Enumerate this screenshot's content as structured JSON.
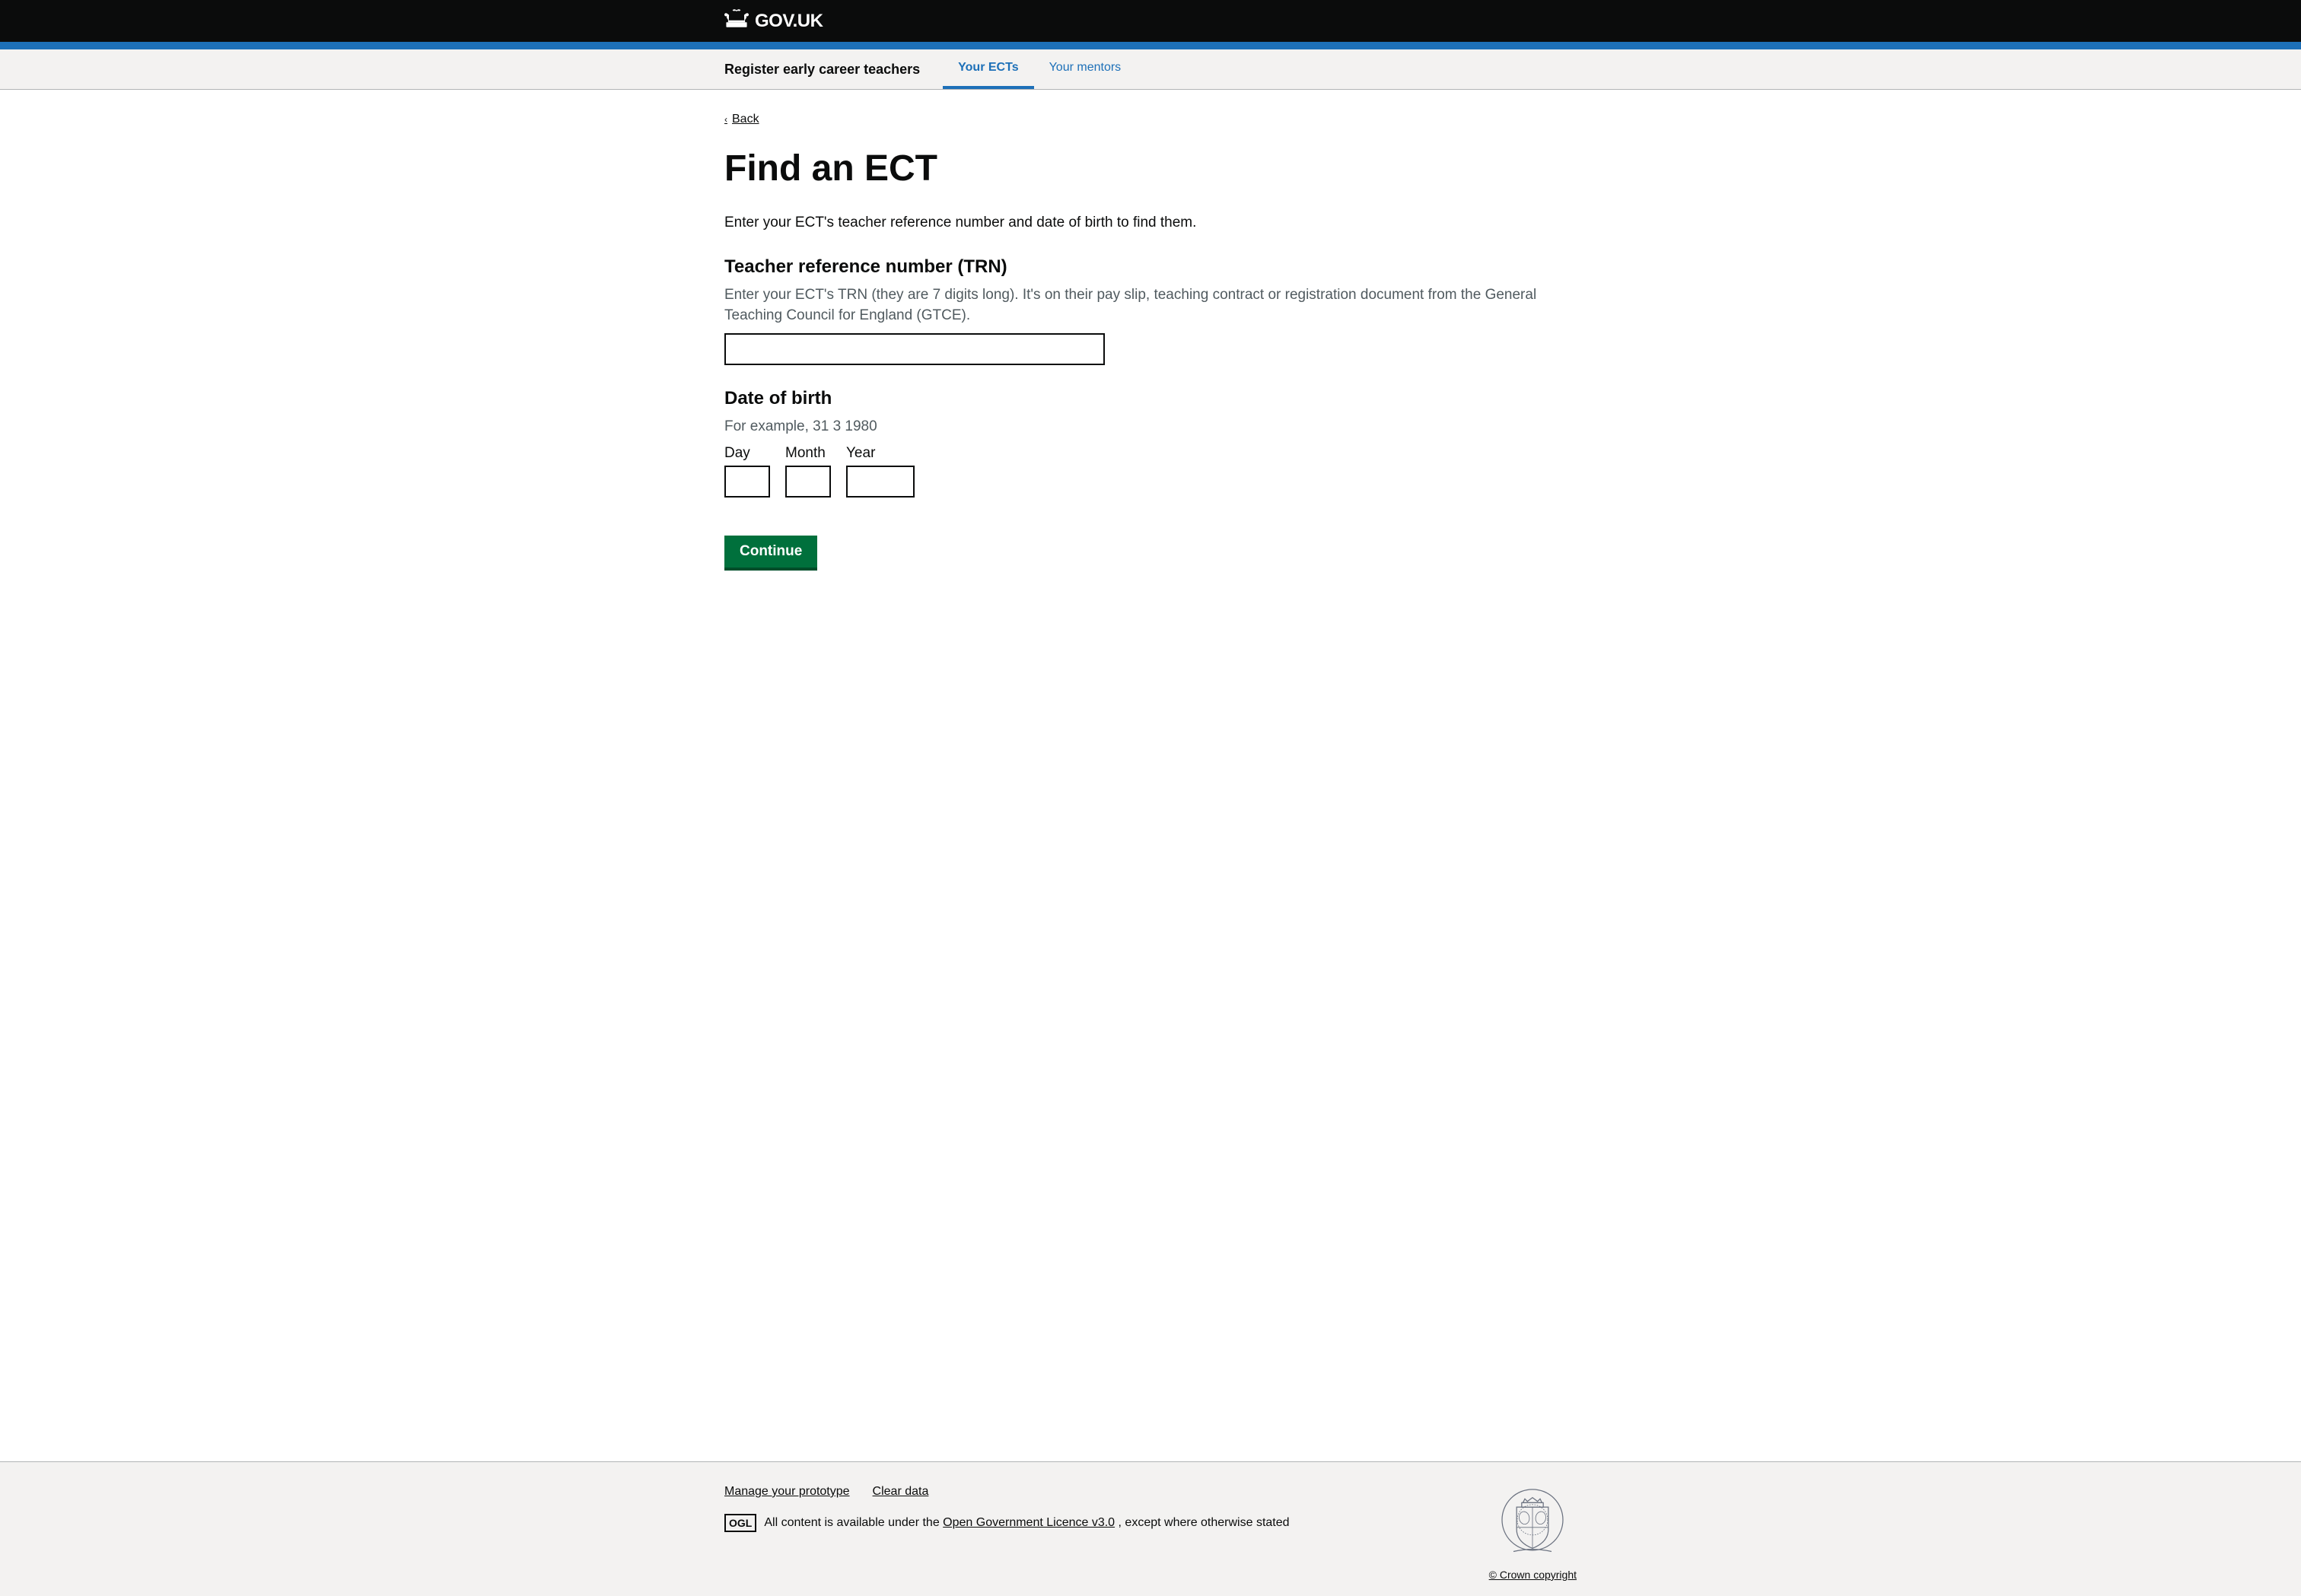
{
  "header": {
    "logo_text": "GOV.UK",
    "logo_link": "/",
    "border_color": "#1d70b8"
  },
  "nav": {
    "service_name": "Register early career teachers",
    "links": [
      {
        "id": "your-ects",
        "label": "Your ECTs",
        "active": true
      },
      {
        "id": "your-mentors",
        "label": "Your mentors",
        "active": false
      }
    ]
  },
  "back": {
    "label": "Back",
    "chevron": "<"
  },
  "main": {
    "heading": "Find an ECT",
    "intro": "Enter your ECT's teacher reference number and date of birth to find them.",
    "trn_section": {
      "label": "Teacher reference number (TRN)",
      "hint": "Enter your ECT's TRN (they are 7 digits long). It's on their pay slip, teaching contract or registration document from the General Teaching Council for England (GTCE).",
      "input_placeholder": ""
    },
    "dob_section": {
      "label": "Date of birth",
      "hint": "For example, 31 3 1980",
      "day_label": "Day",
      "month_label": "Month",
      "year_label": "Year",
      "day_value": "",
      "month_value": "",
      "year_value": ""
    },
    "continue_button": "Continue"
  },
  "footer": {
    "manage_link": "Manage your prototype",
    "clear_link": "Clear data",
    "ogl_label": "OGL",
    "licence_text": "All content is available under the",
    "licence_link_text": "Open Government Licence v3.0",
    "licence_suffix": ", except where otherwise stated",
    "copyright_link": "© Crown copyright"
  }
}
